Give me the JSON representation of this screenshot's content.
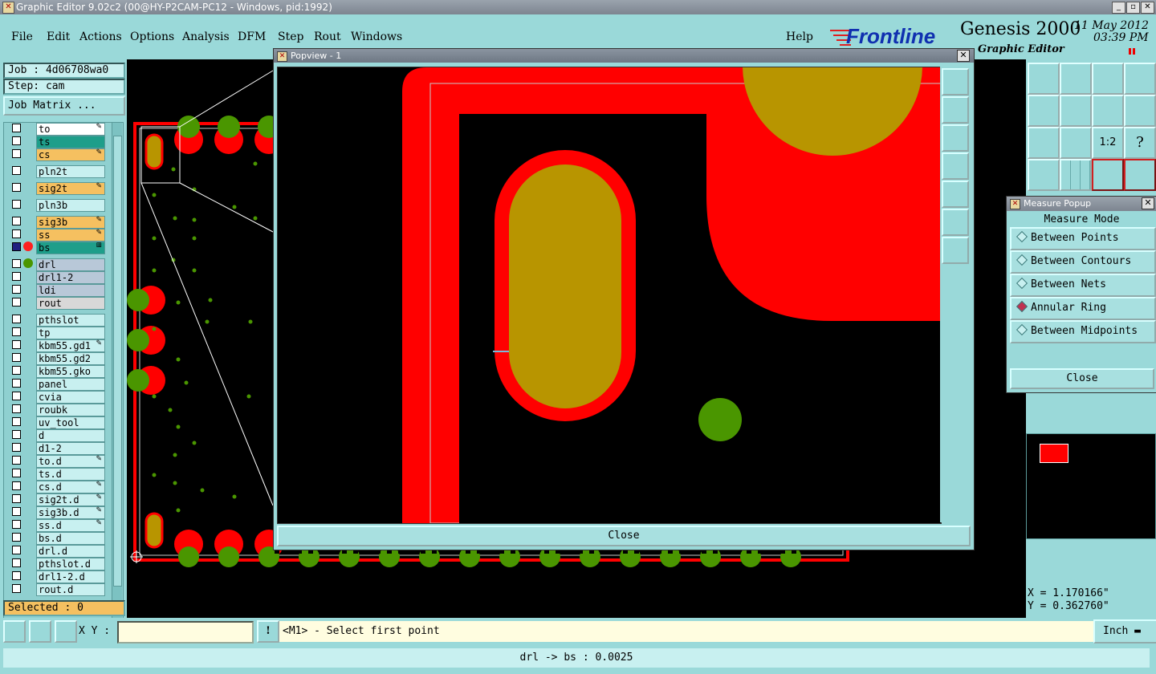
{
  "window": {
    "title": "Graphic Editor 9.02c2 (00@HY-P2CAM-PC12 - Windows, pid:1992)"
  },
  "menu": {
    "items": [
      "File",
      "Edit",
      "Actions",
      "Options",
      "Analysis",
      "DFM",
      "Step",
      "Rout",
      "Windows"
    ],
    "help": "Help"
  },
  "brand": {
    "logo": "Frontline",
    "product": "Genesis 2000",
    "subtitle": "Graphic Editor",
    "date": "11 May 2012",
    "time": "03:39 PM"
  },
  "job": {
    "job_label": "Job : 4d06708wa0",
    "step_label": "Step: cam",
    "matrix_button": "Job Matrix ..."
  },
  "layers": [
    {
      "name": "to",
      "color": "#ffffff",
      "mark": "✎"
    },
    {
      "name": "ts",
      "color": "#1e9e8a",
      "mark": ""
    },
    {
      "name": "cs",
      "color": "#f5c060",
      "mark": "✎"
    },
    {
      "name": "pln2t",
      "color": "#c8f0f0",
      "mark": ""
    },
    {
      "name": "sig2t",
      "color": "#f5c060",
      "mark": "✎"
    },
    {
      "name": "pln3b",
      "color": "#c8f0f0",
      "mark": ""
    },
    {
      "name": "sig3b",
      "color": "#f5c060",
      "mark": "✎"
    },
    {
      "name": "ss",
      "color": "#f5c060",
      "mark": "✎"
    },
    {
      "name": "bs",
      "color": "#1e9e8a",
      "mark": "⊞"
    },
    {
      "name": "drl",
      "color": "#b8c8d8",
      "mark": ""
    },
    {
      "name": "drl1-2",
      "color": "#b8c8d8",
      "mark": ""
    },
    {
      "name": "ldi",
      "color": "#b8c8d8",
      "mark": ""
    },
    {
      "name": "rout",
      "color": "#d8d8d8",
      "mark": ""
    },
    {
      "name": "pthslot",
      "color": "#c8f0f0",
      "mark": ""
    },
    {
      "name": "tp",
      "color": "#c8f0f0",
      "mark": ""
    },
    {
      "name": "kbm55.gd1",
      "color": "#c8f0f0",
      "mark": "✎"
    },
    {
      "name": "kbm55.gd2",
      "color": "#c8f0f0",
      "mark": ""
    },
    {
      "name": "kbm55.gko",
      "color": "#c8f0f0",
      "mark": ""
    },
    {
      "name": "panel",
      "color": "#c8f0f0",
      "mark": ""
    },
    {
      "name": "cvia",
      "color": "#c8f0f0",
      "mark": ""
    },
    {
      "name": "roubk",
      "color": "#c8f0f0",
      "mark": ""
    },
    {
      "name": "uv_tool",
      "color": "#c8f0f0",
      "mark": ""
    },
    {
      "name": "d",
      "color": "#c8f0f0",
      "mark": ""
    },
    {
      "name": "d1-2",
      "color": "#c8f0f0",
      "mark": ""
    },
    {
      "name": "to.d",
      "color": "#c8f0f0",
      "mark": "✎"
    },
    {
      "name": "ts.d",
      "color": "#c8f0f0",
      "mark": ""
    },
    {
      "name": "cs.d",
      "color": "#c8f0f0",
      "mark": "✎"
    },
    {
      "name": "sig2t.d",
      "color": "#c8f0f0",
      "mark": "✎"
    },
    {
      "name": "sig3b.d",
      "color": "#c8f0f0",
      "mark": "✎"
    },
    {
      "name": "ss.d",
      "color": "#c8f0f0",
      "mark": "✎"
    },
    {
      "name": "bs.d",
      "color": "#c8f0f0",
      "mark": ""
    },
    {
      "name": "drl.d",
      "color": "#c8f0f0",
      "mark": ""
    },
    {
      "name": "pthslot.d",
      "color": "#c8f0f0",
      "mark": ""
    },
    {
      "name": "drl1-2.d",
      "color": "#c8f0f0",
      "mark": ""
    },
    {
      "name": "rout.d",
      "color": "#c8f0f0",
      "mark": ""
    }
  ],
  "selected": "Selected : 0",
  "popview": {
    "title": "Popview - 1",
    "close_label": "Close"
  },
  "measure": {
    "title": "Measure Popup",
    "mode_label": "Measure Mode",
    "options": [
      "Between Points",
      "Between Contours",
      "Between Nets",
      "Annular Ring",
      "Between Midpoints"
    ],
    "selected": "Annular Ring",
    "close_label": "Close"
  },
  "coords": {
    "x": "X = 1.170166\"",
    "y": "Y = 0.362760\""
  },
  "status": {
    "xy_label": "X Y :",
    "xy_value": "",
    "prompt": "<M1> - Select first point",
    "units": "Inch",
    "result": "drl -> bs : 0.0025"
  },
  "colors": {
    "panel": "#9ad9d9",
    "copper": "#ff0000",
    "pad": "#b89500",
    "drill": "#4a9600"
  }
}
